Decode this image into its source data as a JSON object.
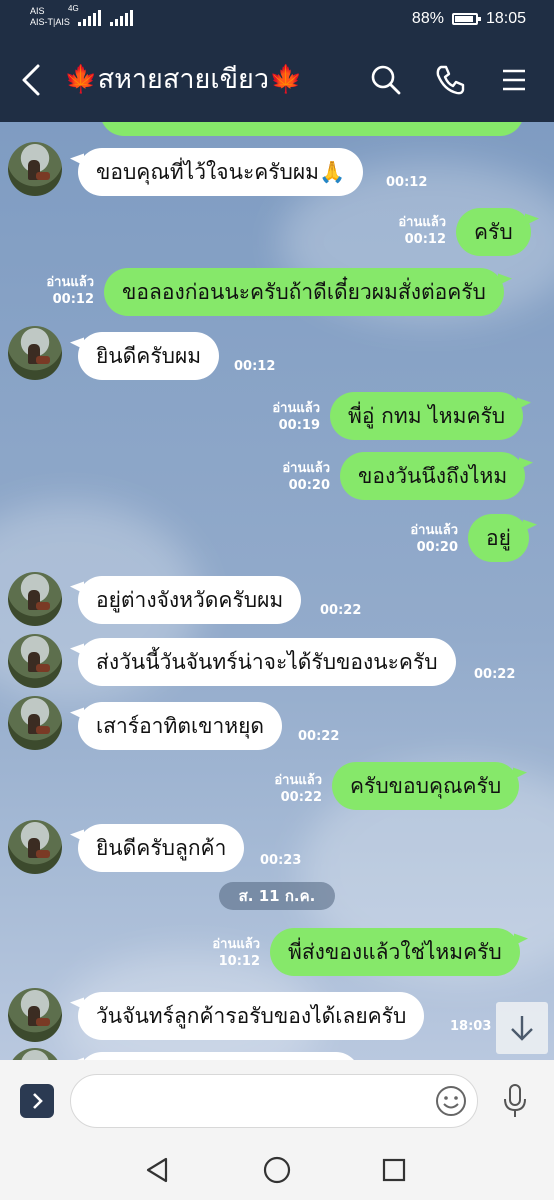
{
  "status_bar": {
    "carrier1": "AIS",
    "carrier2": "AIS-T|AIS",
    "network": "4G",
    "battery": "88%",
    "battery_level": 0.88,
    "time": "18:05"
  },
  "header": {
    "title": "🍁สหายสายเขียว🍁",
    "icons": [
      "back-icon",
      "search-icon",
      "phone-icon",
      "menu-icon"
    ]
  },
  "messages": [
    {
      "side": "in",
      "text": "ขอบคุณที่ไว้ใจนะครับผม🙏",
      "time": "00:12"
    },
    {
      "side": "out",
      "text": "ครับ",
      "read": "อ่านแล้ว",
      "time": "00:12"
    },
    {
      "side": "out",
      "text": "ขอลองก่อนนะครับถ้าดีเดี๋ยวผมสั่งต่อครับ",
      "read": "อ่านแล้ว",
      "time": "00:12"
    },
    {
      "side": "in",
      "text": "ยินดีครับผม",
      "time": "00:12"
    },
    {
      "side": "out",
      "text": "พี่อู่ กทม ไหมครับ",
      "read": "อ่านแล้ว",
      "time": "00:19"
    },
    {
      "side": "out",
      "text": "ของวันนึงถึงไหม",
      "read": "อ่านแล้ว",
      "time": "00:20"
    },
    {
      "side": "out",
      "text": "อยู่",
      "read": "อ่านแล้ว",
      "time": "00:20"
    },
    {
      "side": "in",
      "text": "อยู่ต่างจังหวัดครับผม",
      "time": "00:22"
    },
    {
      "side": "in",
      "text": "ส่งวันนี้วันจันทร์น่าจะได้รับของนะครับ",
      "time": "00:22"
    },
    {
      "side": "in",
      "text": "เสาร์อาทิตเขาหยุด",
      "time": "00:22"
    },
    {
      "side": "out",
      "text": "ครับขอบคุณครับ",
      "read": "อ่านแล้ว",
      "time": "00:22"
    },
    {
      "side": "in",
      "text": "ยินดีครับลูกค้า",
      "time": "00:23"
    },
    {
      "side": "out",
      "text": "พี่ส่งของแล้วใช่ไหมครับ",
      "read": "อ่านแล้ว",
      "time": "10:12"
    },
    {
      "side": "in",
      "text": "วันจันทร์ลูกค้ารอรับของได้เลยครับ",
      "time": "18:03"
    }
  ],
  "date_separator": "ส. 11 ก.ค.",
  "input": {
    "value": "",
    "placeholder": ""
  },
  "colors": {
    "header": "#1f2e44",
    "bubble_out": "#86e86a",
    "bubble_in": "#ffffff",
    "chat_bg": "#8aa3c4"
  }
}
